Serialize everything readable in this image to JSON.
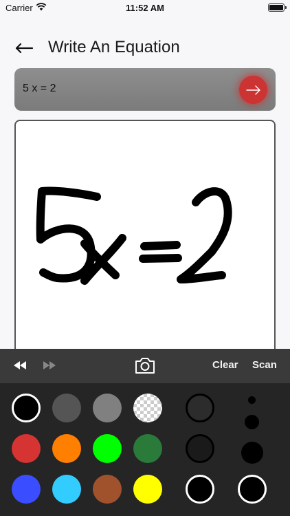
{
  "status": {
    "carrier": "Carrier",
    "time": "11:52 AM"
  },
  "header": {
    "title": "Write An Equation"
  },
  "equation": {
    "value": "5 x = 2"
  },
  "canvas": {
    "drawing": "5x=2"
  },
  "toolbar": {
    "clear_label": "Clear",
    "scan_label": "Scan"
  },
  "colors": {
    "accent": "#cc3333",
    "pen_colors": [
      "#000000",
      "#555555",
      "#808080",
      "transparent",
      "#d63333",
      "#ff7f00",
      "#00ff00",
      "#2a7a3a",
      "#3a4dff",
      "#33ccff",
      "#a0522d",
      "#ffff00"
    ],
    "selected_pen": "#000000"
  },
  "icons": [
    "back-arrow-icon",
    "submit-arrow-icon",
    "rewind-icon",
    "fast-forward-icon",
    "camera-icon",
    "wifi-icon",
    "battery-icon"
  ]
}
